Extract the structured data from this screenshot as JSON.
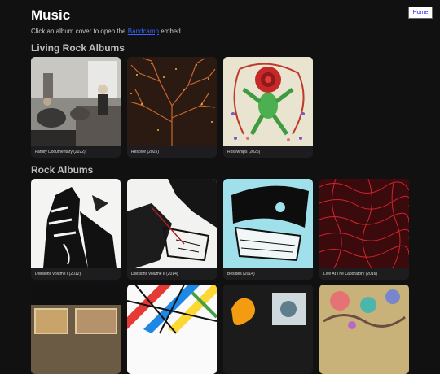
{
  "header": {
    "title": "Music",
    "intro_prefix": "Click an album cover to open the ",
    "intro_link": "Bandcamp",
    "intro_suffix": " embed.",
    "home_button": "Home"
  },
  "sections": [
    {
      "title": "Living Rock Albums",
      "albums": [
        {
          "caption": "Family Documentary (2022)"
        },
        {
          "caption": "Resolve (2025)"
        },
        {
          "caption": "Rosewhips (2025)"
        }
      ]
    },
    {
      "title": "Rock Albums",
      "albums": [
        {
          "caption": "Divisions volume I (2012)"
        },
        {
          "caption": "Divisions volume II (2014)"
        },
        {
          "caption": "Besides (2014)"
        },
        {
          "caption": "Live At The Laboratory (2016)"
        },
        {
          "caption": ""
        },
        {
          "caption": ""
        },
        {
          "caption": ""
        },
        {
          "caption": ""
        }
      ]
    }
  ]
}
